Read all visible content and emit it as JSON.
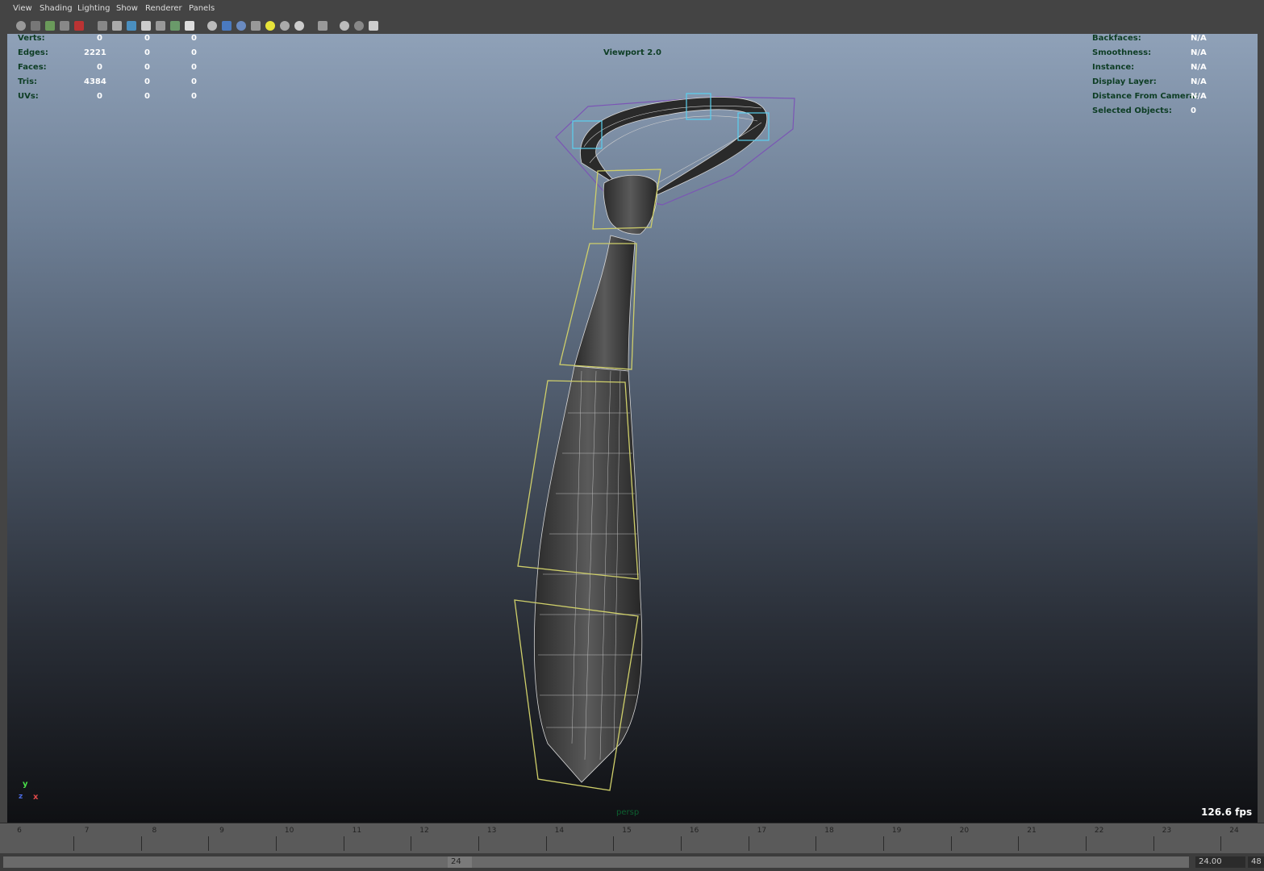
{
  "menu": [
    "View",
    "Shading",
    "Lighting",
    "Show",
    "Renderer",
    "Panels"
  ],
  "toolbar_icons": [
    "camera-select-icon",
    "camera-lock-icon",
    "film-gate-icon",
    "image-plane-icon",
    "resolution-gate-icon",
    "wireframe-icon",
    "smooth-shade-icon",
    "textured-icon",
    "lights-icon",
    "shadows-icon",
    "isolate-icon",
    "xray-icon",
    "default-lighting-icon",
    "all-lights-icon",
    "sphere-shade-icon",
    "bookmark-icon",
    "grid-icon",
    "ambient-occlusion-icon",
    "share-icon"
  ],
  "hud": {
    "stats": [
      {
        "label": "Verts:",
        "values": [
          "0",
          "0",
          "0"
        ]
      },
      {
        "label": "Edges:",
        "values": [
          "2221",
          "0",
          "0"
        ]
      },
      {
        "label": "Faces:",
        "values": [
          "0",
          "0",
          "0"
        ]
      },
      {
        "label": "Tris:",
        "values": [
          "4384",
          "0",
          "0"
        ]
      },
      {
        "label": "UVs:",
        "values": [
          "0",
          "0",
          "0"
        ]
      }
    ],
    "renderer_label": "Viewport 2.0",
    "right": [
      {
        "label": "Backfaces:",
        "value": "N/A"
      },
      {
        "label": "Smoothness:",
        "value": "N/A"
      },
      {
        "label": "Instance:",
        "value": "N/A"
      },
      {
        "label": "Display Layer:",
        "value": "N/A"
      },
      {
        "label": "Distance From Camera:",
        "value": "N/A"
      },
      {
        "label": "Selected Objects:",
        "value": "0"
      }
    ],
    "camera": "persp",
    "fps": "126.6 fps"
  },
  "axis": {
    "y": "y",
    "x": "x",
    "z": "z"
  },
  "colors": {
    "hud_label": "#0d3d24",
    "wire": "#d7d7d7",
    "cage_yellow": "#cfcf6a",
    "cage_purple": "#7b55b5",
    "cage_cyan": "#5ad0f0"
  },
  "timeline": {
    "ticks": [
      "6",
      "7",
      "8",
      "9",
      "10",
      "11",
      "12",
      "13",
      "14",
      "15",
      "16",
      "17",
      "18",
      "19",
      "20",
      "21",
      "22",
      "23",
      "24"
    ]
  },
  "range": {
    "current": "24",
    "end_time": "24.00",
    "extra": "48"
  }
}
